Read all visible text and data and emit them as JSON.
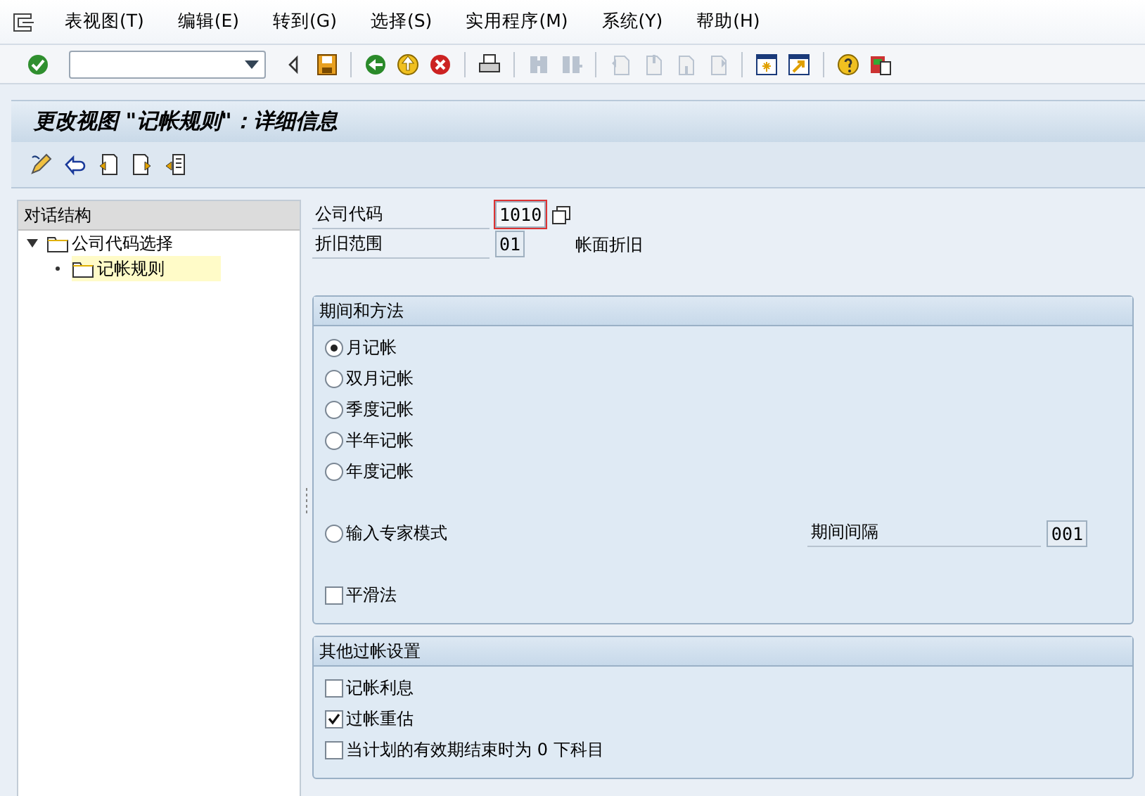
{
  "menu_bar": {
    "items": [
      "表视图(T)",
      "编辑(E)",
      "转到(G)",
      "选择(S)",
      "实用程序(M)",
      "系统(Y)",
      "帮助(H)"
    ]
  },
  "system_toolbar": {
    "buttons": [
      {
        "kind": "enter",
        "disabled": false
      },
      {
        "kind": "command-field",
        "disabled": false
      },
      {
        "kind": "collapse",
        "disabled": false
      },
      {
        "kind": "save",
        "disabled": false
      },
      {
        "kind": "back",
        "disabled": false
      },
      {
        "kind": "exit",
        "disabled": false
      },
      {
        "kind": "cancel",
        "disabled": false
      },
      {
        "kind": "print",
        "disabled": false
      },
      {
        "kind": "find",
        "disabled": true
      },
      {
        "kind": "find-next",
        "disabled": true
      },
      {
        "kind": "first-page",
        "disabled": true
      },
      {
        "kind": "prev-page",
        "disabled": true
      },
      {
        "kind": "next-page",
        "disabled": true
      },
      {
        "kind": "last-page",
        "disabled": true
      },
      {
        "kind": "new-session",
        "disabled": false
      },
      {
        "kind": "shortcut",
        "disabled": false
      },
      {
        "kind": "help",
        "disabled": false
      },
      {
        "kind": "layout",
        "disabled": false
      }
    ]
  },
  "title": "更改视图 \"记帐规则\"：详细信息",
  "app_toolbar": {
    "buttons": [
      {
        "kind": "display-change"
      },
      {
        "kind": "undo"
      },
      {
        "kind": "prev-entry"
      },
      {
        "kind": "next-entry"
      },
      {
        "kind": "other-entry"
      }
    ]
  },
  "dialog_structure": {
    "header": "对话结构",
    "items": [
      {
        "label": "公司代码选择",
        "expanded": true,
        "selected": false,
        "children": [
          {
            "label": "记帐规则",
            "selected": true
          }
        ]
      }
    ]
  },
  "fields": [
    {
      "label": "公司代码",
      "value": "1010",
      "focused": true
    },
    {
      "label": "折旧范围",
      "value": "01",
      "focused": false,
      "description": "帐面折旧"
    }
  ],
  "period_group": {
    "title": "期间和方法",
    "radios": [
      {
        "label": "月记帐",
        "checked": true
      },
      {
        "label": "双月记帐",
        "checked": false
      },
      {
        "label": "季度记帐",
        "checked": false
      },
      {
        "label": "半年记帐",
        "checked": false
      },
      {
        "label": "年度记帐",
        "checked": false
      }
    ],
    "expert_mode": {
      "label": "输入专家模式",
      "checked": false,
      "interval_label": "期间间隔",
      "interval_value": "001"
    },
    "smoothing": {
      "label": "平滑法",
      "checked": false
    }
  },
  "posting_group": {
    "title": "其他过帐设置",
    "checkboxes": [
      {
        "label": "记帐利息",
        "checked": false
      },
      {
        "label": "过帐重估",
        "checked": true
      },
      {
        "label": "当计划的有效期结束时为 0 下科目",
        "checked": false
      }
    ]
  }
}
